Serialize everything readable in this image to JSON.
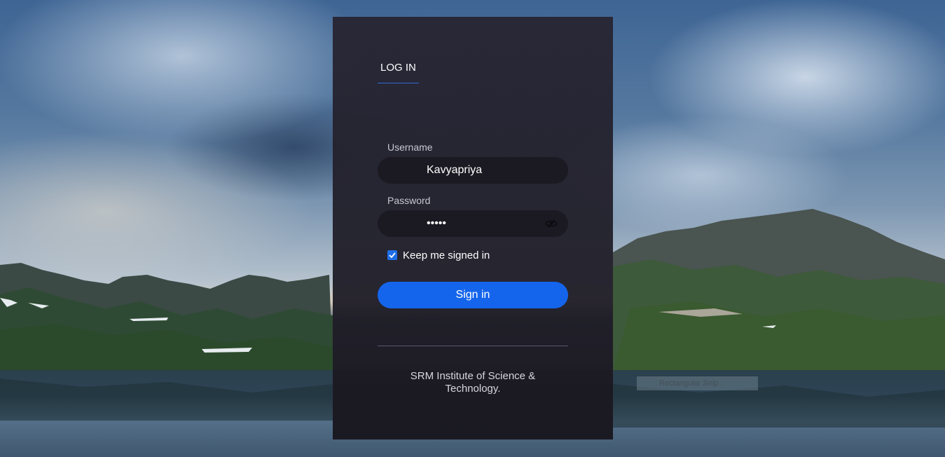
{
  "login": {
    "tab_label": "LOG IN",
    "username_label": "Username",
    "username_value": "Kavyapriya",
    "password_label": "Password",
    "password_value": "•••••",
    "keep_signed_in_label": "Keep me signed in",
    "keep_signed_in_checked": true,
    "sign_in_label": "Sign in",
    "footer_line1": "SRM Institute of Science &",
    "footer_line2": "Technology."
  },
  "overlay": {
    "snip_label": "Rectangular Snip"
  },
  "icons": {
    "password_toggle": "eye-off-icon",
    "checkbox": "check-icon"
  },
  "colors": {
    "accent": "#1565ec",
    "panel": "#26242f",
    "input": "#1b1a22"
  }
}
